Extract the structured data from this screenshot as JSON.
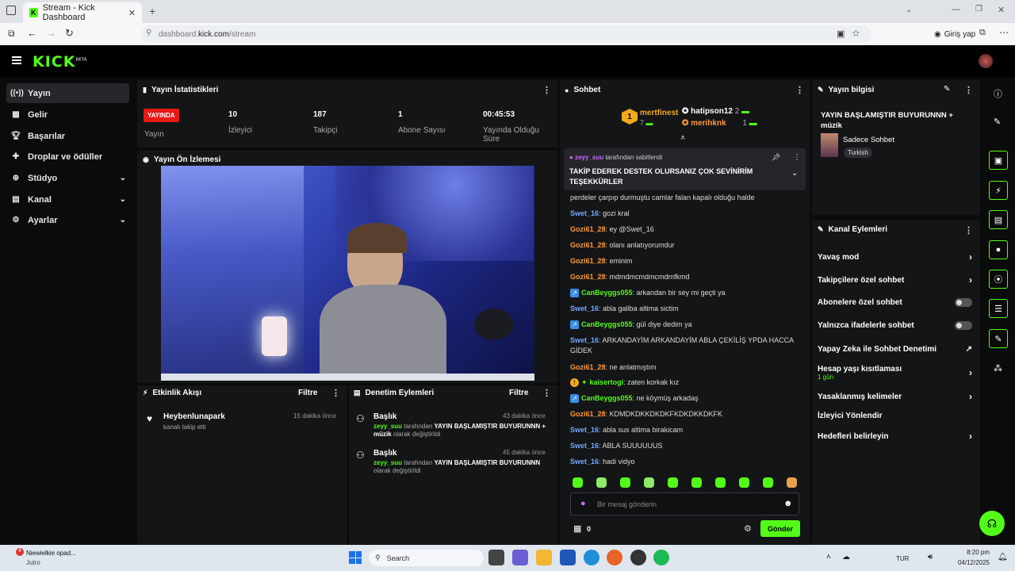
{
  "browser": {
    "tab_title": "Stream - Kick Dashboard",
    "url_prefix": "dashboard.",
    "url_domain": "kick.com",
    "url_path": "/stream",
    "sign_in_label": "Giriş yap"
  },
  "brand": {
    "logo_text": "KICK",
    "logo_badge": "BETA",
    "accent": "#53fc18"
  },
  "sidebar": {
    "items": [
      {
        "label": "Yayın",
        "icon": "broadcast-icon",
        "active": true
      },
      {
        "label": "Gelir",
        "icon": "revenue-icon"
      },
      {
        "label": "Başarılar",
        "icon": "trophy-icon"
      },
      {
        "label": "Droplar ve ödüller",
        "icon": "gift-icon"
      },
      {
        "label": "Stüdyo",
        "icon": "studio-icon",
        "expandable": true
      },
      {
        "label": "Kanal",
        "icon": "channel-icon",
        "expandable": true
      },
      {
        "label": "Ayarlar",
        "icon": "gear-icon",
        "expandable": true
      }
    ]
  },
  "stats": {
    "title": "Yayın İstatistikleri",
    "live_badge": "YAYINDA",
    "stream_label": "Yayın",
    "viewers_value": "10",
    "viewers_label": "İzleyici",
    "followers_value": "187",
    "followers_label": "Takipçi",
    "subs_value": "1",
    "subs_label": "Abone Sayısı",
    "uptime_value": "00:45:53",
    "uptime_label": "Yayında Olduğu Süre"
  },
  "preview": {
    "title": "Yayın Ön İzlemesi"
  },
  "activity": {
    "title": "Etkinlik Akışı",
    "filter": "Filtre",
    "items": [
      {
        "user": "Heybenlunapark",
        "text": "kanalı takip etti",
        "time": "15 dakika önce"
      }
    ]
  },
  "moderation": {
    "title": "Denetim Eylemleri",
    "filter": "Filtre",
    "items": [
      {
        "title": "Başlık",
        "time": "43 dakika önce",
        "user": "zeyy_suu",
        "mid": " tarafından ",
        "value": "YAYIN BAŞLAMIŞTIR BUYURUNNN + müzik",
        "suffix": " olarak değiştirildi"
      },
      {
        "title": "Başlık",
        "time": "45 dakika önce",
        "user": "zeyy_suu",
        "mid": " tarafından ",
        "value": "YAYIN BAŞLAMIŞTIR BUYURUNNN",
        "suffix": " olarak değiştirildi"
      }
    ]
  },
  "chat": {
    "title": "Sohbet",
    "top_gifters": [
      {
        "rank": "1",
        "name": "mertfinest",
        "count": "7"
      },
      {
        "name": "hatipson12",
        "count": "2"
      },
      {
        "name": "merihknk",
        "count": "1"
      }
    ],
    "pinned_user": "zeyy_suu",
    "pinned_by": " tarafından sabitlendi",
    "pinned_text": "TAKİP EDEREK DESTEK OLURSANIZ ÇOK SEVİNİRİM TEŞEKKÜRLER",
    "messages": [
      {
        "user": "",
        "text": "perdeler çarpıp durmuştu camlar falan kapalı olduğu halde",
        "color": "white"
      },
      {
        "user": "Swet_16",
        "text": ": gozi kral",
        "color": "blue"
      },
      {
        "user": "Gozi61_28",
        "text": ": ey @Swet_16",
        "color": "orange"
      },
      {
        "user": "Gozi61_28",
        "text": ": olanı anlatıyorumdur",
        "color": "orange"
      },
      {
        "user": "Gozi61_28",
        "text": ": eminim",
        "color": "orange"
      },
      {
        "user": "Gozi61_28",
        "text": ": mdmdmcmdmcmdmfkmd",
        "color": "orange"
      },
      {
        "user": "CanBeyggs055",
        "text": ": arkandan bir sey mi geçti ya",
        "color": "green",
        "badge": true
      },
      {
        "user": "Swet_16",
        "text": ": abla galiba altima sictim",
        "color": "blue"
      },
      {
        "user": "CanBeyggs055",
        "text": ": gül diye dedim ya",
        "color": "green",
        "badge": true
      },
      {
        "user": "Swet_16",
        "text": ": ARKANDAYİM ARKANDAYİM ABLA ÇEKİLİŞ YPDA HACCA GİDEK",
        "color": "blue"
      },
      {
        "user": "Gozi61_28",
        "text": ": ne anlatmıştım",
        "color": "orange"
      },
      {
        "user": "kaisertogi",
        "text": ": zaten korkak kız",
        "color": "green",
        "badge2": true
      },
      {
        "user": "CanBeyggs055",
        "text": ": ne köymüş arkadaş",
        "color": "green",
        "badge": true
      },
      {
        "user": "Gozi61_28",
        "text": ": KDMDKDKKDKDKFKDKDKKDKFK",
        "color": "orange"
      },
      {
        "user": "Swet_16",
        "text": ": abla sus altima birakicam",
        "color": "blue"
      },
      {
        "user": "Swet_16",
        "text": ": ABLA SUUUUUUS",
        "color": "blue"
      },
      {
        "user": "Swet_16",
        "text": ": hadi vidyo",
        "color": "blue"
      }
    ],
    "input_placeholder": "Bir mesaj gönderin",
    "points": "0",
    "send_label": "Gönder"
  },
  "stream_info": {
    "title": "Yayın bilgisi",
    "stream_title": "YAYIN BAŞLAMIŞTIR BUYURUNNN + müzik",
    "category": "Sadece Sohbet",
    "tag": "Turkish"
  },
  "channel_actions": {
    "title": "Kanal Eylemleri",
    "slow_mode": "Yavaş mod",
    "followers_only": "Takipçilere özel sohbet",
    "subs_only": "Abonelere özel sohbet",
    "emotes_only": "Yalnızca ifadelerle sohbet",
    "ai_moderation": "Yapay Zeka ile Sohbet Denetimi",
    "account_age": "Hesap yaşı kısıtlaması",
    "account_age_value": "1 gün",
    "banned_words": "Yasaklanmış kelimeler",
    "raid": "İzleyici Yönlendir",
    "goals": "Hedefleri belirleyin"
  },
  "taskbar": {
    "notification_title": "Niewielkie opad...",
    "notification_sub": "Jutro",
    "search_placeholder": "Search",
    "lang": "TUR",
    "time": "8:20 pm",
    "date": "04/12/2025"
  }
}
